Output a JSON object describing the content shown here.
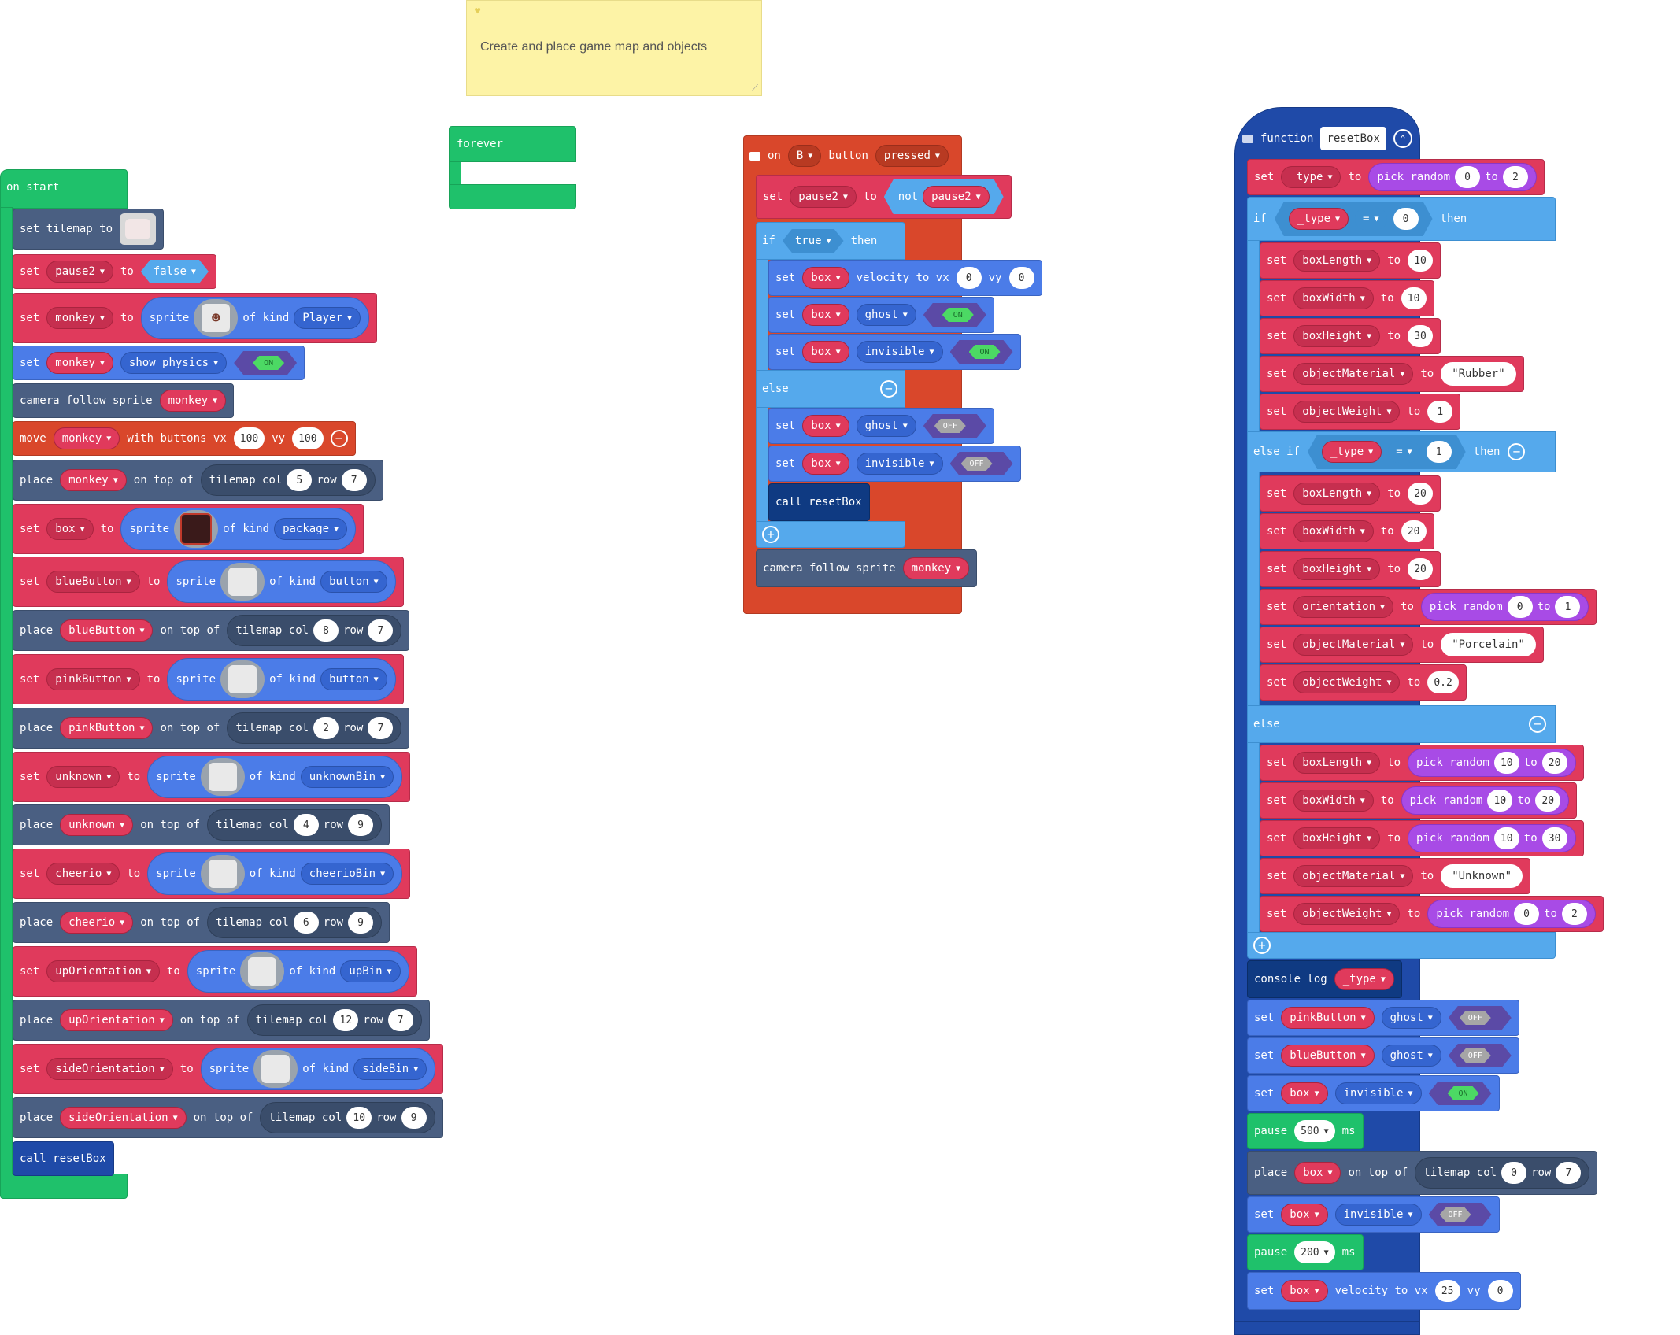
{
  "note": {
    "text": "Create and place game map and objects"
  },
  "forever": {
    "label": "forever"
  },
  "on_start": {
    "hat": "on start",
    "rows": {
      "tilemap": {
        "set": "set tilemap to"
      },
      "pause2": {
        "set": "set",
        "var": "pause2",
        "to": "to",
        "value": "false"
      },
      "monkey": {
        "set": "set",
        "var": "monkey",
        "to": "to",
        "sprite": "sprite",
        "kind_label": "of kind",
        "kind": "Player"
      },
      "physics": {
        "set": "set",
        "var": "monkey",
        "prop": "show physics",
        "toggle": "ON"
      },
      "camera": {
        "label": "camera follow sprite",
        "var": "monkey"
      },
      "move": {
        "label": "move",
        "var": "monkey",
        "mid": "with buttons vx",
        "vx": "100",
        "vy_label": "vy",
        "vy": "100"
      },
      "place_monkey": {
        "place": "place",
        "var": "monkey",
        "on": "on top of",
        "tm": "tilemap col",
        "col": "5",
        "row_label": "row",
        "row": "7"
      },
      "box": {
        "set": "set",
        "var": "box",
        "to": "to",
        "sprite": "sprite",
        "kind_label": "of kind",
        "kind": "package"
      },
      "blue": {
        "set": "set",
        "var": "blueButton",
        "to": "to",
        "sprite": "sprite",
        "kind_label": "of kind",
        "kind": "button"
      },
      "place_blue": {
        "place": "place",
        "var": "blueButton",
        "on": "on top of",
        "tm": "tilemap col",
        "col": "8",
        "row_label": "row",
        "row": "7"
      },
      "pink": {
        "set": "set",
        "var": "pinkButton",
        "to": "to",
        "sprite": "sprite",
        "kind_label": "of kind",
        "kind": "button"
      },
      "place_pink": {
        "place": "place",
        "var": "pinkButton",
        "on": "on top of",
        "tm": "tilemap col",
        "col": "2",
        "row_label": "row",
        "row": "7"
      },
      "unknown": {
        "set": "set",
        "var": "unknown",
        "to": "to",
        "sprite": "sprite",
        "kind_label": "of kind",
        "kind": "unknownBin"
      },
      "place_unknown": {
        "place": "place",
        "var": "unknown",
        "on": "on top of",
        "tm": "tilemap col",
        "col": "4",
        "row_label": "row",
        "row": "9"
      },
      "cheerio": {
        "set": "set",
        "var": "cheerio",
        "to": "to",
        "sprite": "sprite",
        "kind_label": "of kind",
        "kind": "cheerioBin"
      },
      "place_cheerio": {
        "place": "place",
        "var": "cheerio",
        "on": "on top of",
        "tm": "tilemap col",
        "col": "6",
        "row_label": "row",
        "row": "9"
      },
      "up": {
        "set": "set",
        "var": "upOrientation",
        "to": "to",
        "sprite": "sprite",
        "kind_label": "of kind",
        "kind": "upBin"
      },
      "place_up": {
        "place": "place",
        "var": "upOrientation",
        "on": "on top of",
        "tm": "tilemap col",
        "col": "12",
        "row_label": "row",
        "row": "7"
      },
      "side": {
        "set": "set",
        "var": "sideOrientation",
        "to": "to",
        "sprite": "sprite",
        "kind_label": "of kind",
        "kind": "sideBin"
      },
      "place_side": {
        "place": "place",
        "var": "sideOrientation",
        "on": "on top of",
        "tm": "tilemap col",
        "col": "10",
        "row_label": "row",
        "row": "9"
      },
      "call": {
        "label": "call resetBox"
      }
    }
  },
  "on_b": {
    "hat": {
      "on": "on",
      "button": "B",
      "mid": "button",
      "event": "pressed"
    },
    "set_pause": {
      "set": "set",
      "var": "pause2",
      "to": "to",
      "not": "not",
      "arg": "pause2"
    },
    "if": {
      "if": "if",
      "cond": "true",
      "then": "then"
    },
    "velocity": {
      "set": "set",
      "var": "box",
      "label": "velocity to vx",
      "vx": "0",
      "vy_label": "vy",
      "vy": "0"
    },
    "ghost_on": {
      "set": "set",
      "var": "box",
      "prop": "ghost",
      "toggle": "ON"
    },
    "invis_on": {
      "set": "set",
      "var": "box",
      "prop": "invisible",
      "toggle": "ON"
    },
    "else": "else",
    "ghost_off": {
      "set": "set",
      "var": "box",
      "prop": "ghost",
      "toggle": "OFF"
    },
    "invis_off": {
      "set": "set",
      "var": "box",
      "prop": "invisible",
      "toggle": "OFF"
    },
    "call": "call resetBox",
    "camera": {
      "label": "camera follow sprite",
      "var": "monkey"
    }
  },
  "func": {
    "label": "function",
    "name": "resetBox",
    "set_type": {
      "set": "set",
      "var": "_type",
      "to": "to",
      "pick": "pick random",
      "a": "0",
      "to2": "to",
      "b": "2"
    },
    "if1": {
      "if": "if",
      "var": "_type",
      "op": "=",
      "val": "0",
      "then": "then"
    },
    "b1": [
      {
        "set": "set",
        "var": "boxLength",
        "to": "to",
        "val": "10"
      },
      {
        "set": "set",
        "var": "boxWidth",
        "to": "to",
        "val": "10"
      },
      {
        "set": "set",
        "var": "boxHeight",
        "to": "to",
        "val": "30"
      },
      {
        "set": "set",
        "var": "objectMaterial",
        "to": "to",
        "val": "\"Rubber\""
      },
      {
        "set": "set",
        "var": "objectWeight",
        "to": "to",
        "val": "1"
      }
    ],
    "elseif": {
      "label": "else if",
      "var": "_type",
      "op": "=",
      "val": "1",
      "then": "then"
    },
    "b2": [
      {
        "set": "set",
        "var": "boxLength",
        "to": "to",
        "val": "20"
      },
      {
        "set": "set",
        "var": "boxWidth",
        "to": "to",
        "val": "20"
      },
      {
        "set": "set",
        "var": "boxHeight",
        "to": "to",
        "val": "20"
      }
    ],
    "orientation": {
      "set": "set",
      "var": "orientation",
      "to": "to",
      "pick": "pick random",
      "a": "0",
      "to2": "to",
      "b": "1"
    },
    "b2b": [
      {
        "set": "set",
        "var": "objectMaterial",
        "to": "to",
        "val": "\"Porcelain\""
      },
      {
        "set": "set",
        "var": "objectWeight",
        "to": "to",
        "val": "0.2"
      }
    ],
    "else": "else",
    "b3": [
      {
        "set": "set",
        "var": "boxLength",
        "to": "to",
        "pick": "pick random",
        "a": "10",
        "to2": "to",
        "b": "20"
      },
      {
        "set": "set",
        "var": "boxWidth",
        "to": "to",
        "pick": "pick random",
        "a": "10",
        "to2": "to",
        "b": "20"
      },
      {
        "set": "set",
        "var": "boxHeight",
        "to": "to",
        "pick": "pick random",
        "a": "10",
        "to2": "to",
        "b": "30"
      }
    ],
    "b3mat": {
      "set": "set",
      "var": "objectMaterial",
      "to": "to",
      "val": "\"Unknown\""
    },
    "b3w": {
      "set": "set",
      "var": "objectWeight",
      "to": "to",
      "pick": "pick random",
      "a": "0",
      "to2": "to",
      "b": "2"
    },
    "console": {
      "label": "console log",
      "var": "_type"
    },
    "pink_ghost": {
      "set": "set",
      "var": "pinkButton",
      "prop": "ghost",
      "toggle": "OFF"
    },
    "blue_ghost": {
      "set": "set",
      "var": "blueButton",
      "prop": "ghost",
      "toggle": "OFF"
    },
    "box_invis_on": {
      "set": "set",
      "var": "box",
      "prop": "invisible",
      "toggle": "ON"
    },
    "pause1": {
      "label": "pause",
      "val": "500",
      "unit": "ms"
    },
    "place_box": {
      "place": "place",
      "var": "box",
      "on": "on top of",
      "tm": "tilemap col",
      "col": "0",
      "row_label": "row",
      "row": "7"
    },
    "box_invis_off": {
      "set": "set",
      "var": "box",
      "prop": "invisible",
      "toggle": "OFF"
    },
    "pause2": {
      "label": "pause",
      "val": "200",
      "unit": "ms"
    },
    "velocity": {
      "set": "set",
      "var": "box",
      "label": "velocity to vx",
      "vx": "25",
      "vy_label": "vy",
      "vy": "0"
    }
  }
}
